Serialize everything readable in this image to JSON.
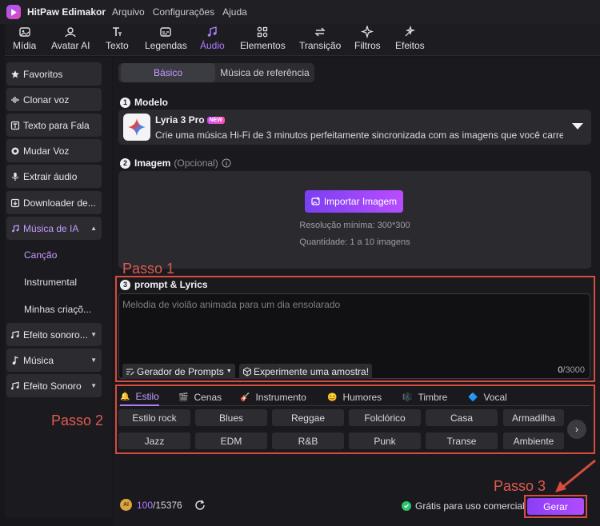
{
  "app": {
    "title": "HitPaw Edimakor"
  },
  "menu": [
    "Arquivo",
    "Configurações",
    "Ajuda"
  ],
  "toolbar": [
    {
      "label": "Mídia",
      "icon": "media-icon"
    },
    {
      "label": "Avatar AI",
      "icon": "avatar-icon"
    },
    {
      "label": "Texto",
      "icon": "text-icon"
    },
    {
      "label": "Legendas",
      "icon": "subtitles-icon"
    },
    {
      "label": "Áudio",
      "icon": "audio-icon",
      "active": true
    },
    {
      "label": "Elementos",
      "icon": "elements-icon"
    },
    {
      "label": "Transição",
      "icon": "transition-icon"
    },
    {
      "label": "Filtros",
      "icon": "filters-icon"
    },
    {
      "label": "Efeitos",
      "icon": "effects-icon"
    }
  ],
  "sidebar": {
    "items": [
      {
        "label": "Favoritos",
        "icon": "star-icon"
      },
      {
        "label": "Clonar voz",
        "icon": "voice-clone-icon"
      },
      {
        "label": "Texto para Fala",
        "icon": "tts-icon"
      },
      {
        "label": "Mudar Voz",
        "icon": "voice-change-icon"
      },
      {
        "label": "Extrair áudio",
        "icon": "mic-icon"
      },
      {
        "label": "Downloader de...",
        "icon": "download-icon"
      },
      {
        "label": "Música de IA",
        "icon": "ai-music-icon",
        "active": true
      },
      {
        "label": "Efeito sonoro...",
        "icon": "sound-effect-icon"
      },
      {
        "label": "Música",
        "icon": "music-note-icon"
      },
      {
        "label": "Efeito Sonoro",
        "icon": "sound-effect-icon"
      }
    ],
    "sub": [
      {
        "label": "Canção",
        "active": true
      },
      {
        "label": "Instrumental"
      },
      {
        "label": "Minhas criaçõ..."
      }
    ]
  },
  "segment": {
    "basic": "Básico",
    "reference": "Música de referência"
  },
  "step1": {
    "num": "1",
    "label": "Modelo"
  },
  "model": {
    "name": "Lyria 3 Pro",
    "badge": "NEW",
    "desc": "Crie uma música Hi-Fi de 3 minutos perfeitamente sincronizada com as imagens que você carre..."
  },
  "step2": {
    "num": "2",
    "label": "Imagem",
    "optional": "(Opcional)"
  },
  "image": {
    "button": "Importar Imagem",
    "resolution": "Resolução mínima: 300*300",
    "quantity": "Quantidade: 1 a 10 imagens"
  },
  "annotations": {
    "passo1": "Passo 1",
    "passo2": "Passo 2",
    "passo3": "Passo 3"
  },
  "step3": {
    "num": "3",
    "label": "prompt & Lyrics"
  },
  "prompt": {
    "placeholder": "Melodia de violão animada para um dia ensolarado",
    "generator": "Gerador de Prompts",
    "sample": "Experimente uma amostra!",
    "count": "0",
    "max": "/3000"
  },
  "style_tabs": [
    {
      "label": "Estilo",
      "icon": "bell-icon",
      "active": true
    },
    {
      "label": "Cenas",
      "icon": "scene-icon"
    },
    {
      "label": "Instrumento",
      "icon": "guitar-icon"
    },
    {
      "label": "Humores",
      "icon": "mood-icon"
    },
    {
      "label": "Timbre",
      "icon": "timbre-icon"
    },
    {
      "label": "Vocal",
      "icon": "vocal-icon"
    }
  ],
  "chips_row1": [
    "Estilo rock",
    "Blues",
    "Reggae",
    "Folclórico",
    "Casa",
    "Armadilha"
  ],
  "chips_row2": [
    "Jazz",
    "EDM",
    "R&B",
    "Punk",
    "Transe",
    "Ambiente"
  ],
  "footer": {
    "coin": "AI",
    "credits_used": "100",
    "credits_total": "/15376",
    "free": "Grátis para uso comercial",
    "generate": "Gerar"
  },
  "colors": {
    "accent": "#b07cff",
    "annotation": "#d94a3f",
    "background": "#17171b"
  }
}
